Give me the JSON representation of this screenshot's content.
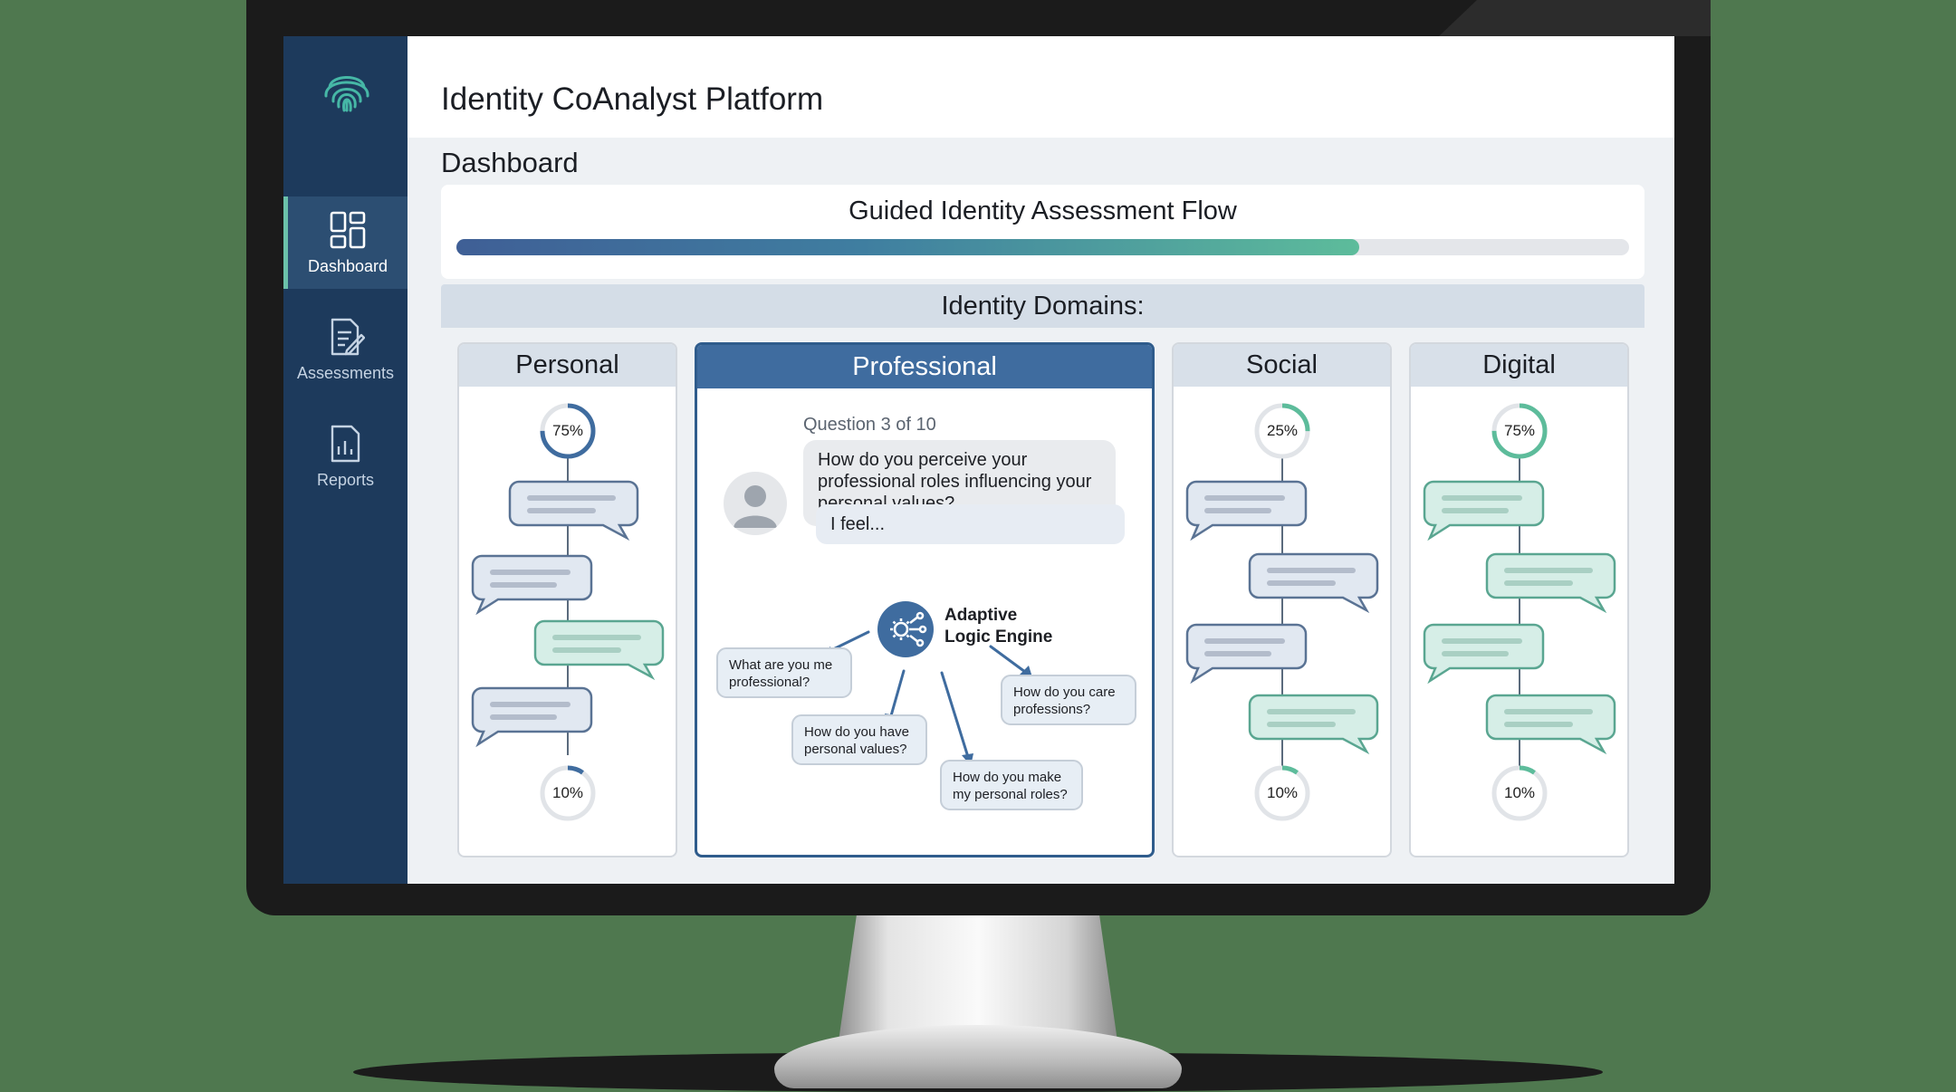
{
  "app": {
    "title": "Identity CoAnalyst Platform"
  },
  "sidebar": {
    "items": [
      {
        "label": "Dashboard",
        "icon": "dashboard-icon",
        "active": true
      },
      {
        "label": "Assessments",
        "icon": "assessment-icon",
        "active": false
      },
      {
        "label": "Reports",
        "icon": "report-icon",
        "active": false
      }
    ]
  },
  "page": {
    "title": "Dashboard"
  },
  "flow": {
    "title": "Guided Identity Assessment Flow",
    "progress": 0.77
  },
  "domains": {
    "heading": "Identity Domains:",
    "personal": {
      "name": "Personal",
      "top_pct": "75%",
      "bottom_pct": "10%"
    },
    "professional": {
      "name": "Professional",
      "question_counter": "Question 3 of 10",
      "question": "How do you perceive your professional roles influencing your personal values?",
      "answer": "I feel...",
      "engine_line1": "Adaptive",
      "engine_line2": "Logic Engine",
      "branches": [
        "What are you me professional?",
        "How do you have personal values?",
        "How do you make my personal roles?",
        "How do you care professions?"
      ]
    },
    "social": {
      "name": "Social",
      "top_pct": "25%",
      "bottom_pct": "10%"
    },
    "digital": {
      "name": "Digital",
      "top_pct": "75%",
      "bottom_pct": "10%"
    }
  },
  "colors": {
    "sidebar_bg": "#1d3a5c",
    "accent_blue": "#3f6c9f",
    "accent_teal": "#5dbc9b"
  }
}
